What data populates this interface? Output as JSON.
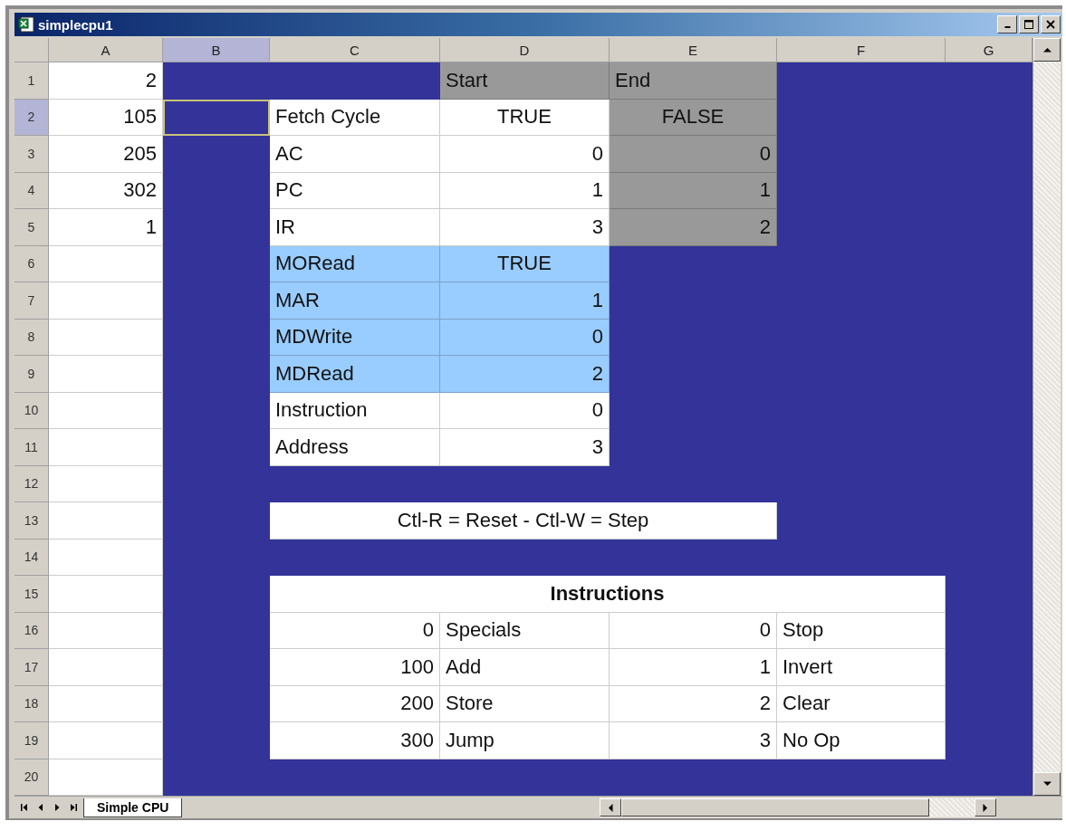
{
  "window": {
    "title": "simplecpu1"
  },
  "sheet": {
    "columns": [
      {
        "label": "A",
        "selected": false
      },
      {
        "label": "B",
        "selected": true
      },
      {
        "label": "C",
        "selected": false
      },
      {
        "label": "D",
        "selected": false
      },
      {
        "label": "E",
        "selected": false
      },
      {
        "label": "F",
        "selected": false
      },
      {
        "label": "G",
        "selected": false
      }
    ],
    "rows": [
      {
        "label": "1",
        "selected": false,
        "cells": [
          {
            "kind": "number",
            "text": "2",
            "color": "#ffffff"
          },
          {
            "kind": "fill"
          },
          {
            "kind": "fill"
          },
          {
            "kind": "label",
            "text": "Start",
            "color": "#999999"
          },
          {
            "kind": "label",
            "text": "End",
            "color": "#999999"
          },
          {
            "kind": "fill"
          },
          {
            "kind": "fill"
          }
        ]
      },
      {
        "label": "2",
        "selected": true,
        "cells": [
          {
            "kind": "number",
            "text": "105",
            "color": "#ffffff"
          },
          {
            "kind": "fill"
          },
          {
            "kind": "label",
            "text": "Fetch Cycle",
            "color": "#ffffff"
          },
          {
            "kind": "flag",
            "text": "TRUE",
            "color": "#ffffff"
          },
          {
            "kind": "flag",
            "text": "FALSE",
            "color": "#999999"
          },
          {
            "kind": "fill"
          },
          {
            "kind": "fill"
          }
        ]
      },
      {
        "label": "3",
        "selected": false,
        "cells": [
          {
            "kind": "number",
            "text": "205",
            "color": "#ffffff"
          },
          {
            "kind": "fill"
          },
          {
            "kind": "label",
            "text": "AC",
            "color": "#ffffff"
          },
          {
            "kind": "number",
            "text": "0",
            "color": "#ffffff"
          },
          {
            "kind": "number",
            "text": "0",
            "color": "#999999"
          },
          {
            "kind": "fill"
          },
          {
            "kind": "fill"
          }
        ]
      },
      {
        "label": "4",
        "selected": false,
        "cells": [
          {
            "kind": "number",
            "text": "302",
            "color": "#ffffff"
          },
          {
            "kind": "fill"
          },
          {
            "kind": "label",
            "text": "PC",
            "color": "#ffffff"
          },
          {
            "kind": "number",
            "text": "1",
            "color": "#ffffff"
          },
          {
            "kind": "number",
            "text": "1",
            "color": "#999999"
          },
          {
            "kind": "fill"
          },
          {
            "kind": "fill"
          }
        ]
      },
      {
        "label": "5",
        "selected": false,
        "cells": [
          {
            "kind": "number",
            "text": "1",
            "color": "#ffffff"
          },
          {
            "kind": "fill"
          },
          {
            "kind": "label",
            "text": "IR",
            "color": "#ffffff"
          },
          {
            "kind": "number",
            "text": "3",
            "color": "#ffffff"
          },
          {
            "kind": "number",
            "text": "2",
            "color": "#999999"
          },
          {
            "kind": "fill"
          },
          {
            "kind": "fill"
          }
        ]
      },
      {
        "label": "6",
        "selected": false,
        "cells": [
          {
            "kind": "empty",
            "color": "#ffffff"
          },
          {
            "kind": "fill"
          },
          {
            "kind": "label",
            "text": "MORead",
            "color": "#99ccff"
          },
          {
            "kind": "flag",
            "text": "TRUE",
            "color": "#99ccff"
          },
          {
            "kind": "fill"
          },
          {
            "kind": "fill"
          },
          {
            "kind": "fill"
          }
        ]
      },
      {
        "label": "7",
        "selected": false,
        "cells": [
          {
            "kind": "empty",
            "color": "#ffffff"
          },
          {
            "kind": "fill"
          },
          {
            "kind": "label",
            "text": "MAR",
            "color": "#99ccff"
          },
          {
            "kind": "number",
            "text": "1",
            "color": "#99ccff"
          },
          {
            "kind": "fill"
          },
          {
            "kind": "fill"
          },
          {
            "kind": "fill"
          }
        ]
      },
      {
        "label": "8",
        "selected": false,
        "cells": [
          {
            "kind": "empty",
            "color": "#ffffff"
          },
          {
            "kind": "fill"
          },
          {
            "kind": "label",
            "text": "MDWrite",
            "color": "#99ccff"
          },
          {
            "kind": "number",
            "text": "0",
            "color": "#99ccff"
          },
          {
            "kind": "fill"
          },
          {
            "kind": "fill"
          },
          {
            "kind": "fill"
          }
        ]
      },
      {
        "label": "9",
        "selected": false,
        "cells": [
          {
            "kind": "empty",
            "color": "#ffffff"
          },
          {
            "kind": "fill"
          },
          {
            "kind": "label",
            "text": "MDRead",
            "color": "#99ccff"
          },
          {
            "kind": "number",
            "text": "2",
            "color": "#99ccff"
          },
          {
            "kind": "fill"
          },
          {
            "kind": "fill"
          },
          {
            "kind": "fill"
          }
        ]
      },
      {
        "label": "10",
        "selected": false,
        "cells": [
          {
            "kind": "empty",
            "color": "#ffffff"
          },
          {
            "kind": "fill"
          },
          {
            "kind": "label",
            "text": "Instruction",
            "color": "#ffffff"
          },
          {
            "kind": "number",
            "text": "0",
            "color": "#ffffff"
          },
          {
            "kind": "fill"
          },
          {
            "kind": "fill"
          },
          {
            "kind": "fill"
          }
        ]
      },
      {
        "label": "11",
        "selected": false,
        "cells": [
          {
            "kind": "empty",
            "color": "#ffffff"
          },
          {
            "kind": "fill"
          },
          {
            "kind": "label",
            "text": "Address",
            "color": "#ffffff"
          },
          {
            "kind": "number",
            "text": "3",
            "color": "#ffffff"
          },
          {
            "kind": "fill"
          },
          {
            "kind": "fill"
          },
          {
            "kind": "fill"
          }
        ]
      },
      {
        "label": "12",
        "selected": false,
        "cells": [
          {
            "kind": "empty",
            "color": "#ffffff"
          },
          {
            "kind": "fill"
          },
          {
            "kind": "fill"
          },
          {
            "kind": "fill"
          },
          {
            "kind": "fill"
          },
          {
            "kind": "fill"
          },
          {
            "kind": "fill"
          }
        ]
      },
      {
        "label": "13",
        "selected": false,
        "cells": [
          {
            "kind": "empty",
            "color": "#ffffff"
          },
          {
            "kind": "fill"
          },
          {
            "kind": "note",
            "text": "Ctl-R = Reset  -  Ctl-W = Step",
            "color": "#ffffff"
          },
          {
            "kind": "covered"
          },
          {
            "kind": "covered"
          },
          {
            "kind": "fill"
          },
          {
            "kind": "fill"
          }
        ]
      },
      {
        "label": "14",
        "selected": false,
        "cells": [
          {
            "kind": "empty",
            "color": "#ffffff"
          },
          {
            "kind": "fill"
          },
          {
            "kind": "fill"
          },
          {
            "kind": "fill"
          },
          {
            "kind": "fill"
          },
          {
            "kind": "fill"
          },
          {
            "kind": "fill"
          }
        ]
      },
      {
        "label": "15",
        "selected": false,
        "cells": [
          {
            "kind": "empty",
            "color": "#ffffff"
          },
          {
            "kind": "fill"
          },
          {
            "kind": "heading",
            "text": "Instructions",
            "color": "#ffffff"
          },
          {
            "kind": "covered"
          },
          {
            "kind": "covered"
          },
          {
            "kind": "covered"
          },
          {
            "kind": "fill"
          }
        ]
      },
      {
        "label": "16",
        "selected": false,
        "cells": [
          {
            "kind": "empty",
            "color": "#ffffff"
          },
          {
            "kind": "fill"
          },
          {
            "kind": "number",
            "text": "0",
            "color": "#ffffff"
          },
          {
            "kind": "label",
            "text": "Specials",
            "color": "#ffffff"
          },
          {
            "kind": "number",
            "text": "0",
            "color": "#ffffff"
          },
          {
            "kind": "label",
            "text": "Stop",
            "color": "#ffffff"
          },
          {
            "kind": "fill"
          }
        ]
      },
      {
        "label": "17",
        "selected": false,
        "cells": [
          {
            "kind": "empty",
            "color": "#ffffff"
          },
          {
            "kind": "fill"
          },
          {
            "kind": "number",
            "text": "100",
            "color": "#ffffff"
          },
          {
            "kind": "label",
            "text": "Add",
            "color": "#ffffff"
          },
          {
            "kind": "number",
            "text": "1",
            "color": "#ffffff"
          },
          {
            "kind": "label",
            "text": "Invert",
            "color": "#ffffff"
          },
          {
            "kind": "fill"
          }
        ]
      },
      {
        "label": "18",
        "selected": false,
        "cells": [
          {
            "kind": "empty",
            "color": "#ffffff"
          },
          {
            "kind": "fill"
          },
          {
            "kind": "number",
            "text": "200",
            "color": "#ffffff"
          },
          {
            "kind": "label",
            "text": "Store",
            "color": "#ffffff"
          },
          {
            "kind": "number",
            "text": "2",
            "color": "#ffffff"
          },
          {
            "kind": "label",
            "text": "Clear",
            "color": "#ffffff"
          },
          {
            "kind": "fill"
          }
        ]
      },
      {
        "label": "19",
        "selected": false,
        "cells": [
          {
            "kind": "empty",
            "color": "#ffffff"
          },
          {
            "kind": "fill"
          },
          {
            "kind": "number",
            "text": "300",
            "color": "#ffffff"
          },
          {
            "kind": "label",
            "text": "Jump",
            "color": "#ffffff"
          },
          {
            "kind": "number",
            "text": "3",
            "color": "#ffffff"
          },
          {
            "kind": "label",
            "text": "No Op",
            "color": "#ffffff"
          },
          {
            "kind": "fill"
          }
        ]
      },
      {
        "label": "20",
        "selected": false,
        "cells": [
          {
            "kind": "empty",
            "color": "#ffffff"
          },
          {
            "kind": "fill"
          },
          {
            "kind": "fill"
          },
          {
            "kind": "fill"
          },
          {
            "kind": "fill"
          },
          {
            "kind": "fill"
          },
          {
            "kind": "fill"
          }
        ]
      }
    ]
  },
  "sheet_tabs": [
    {
      "label": "Simple CPU",
      "selected": true
    }
  ]
}
